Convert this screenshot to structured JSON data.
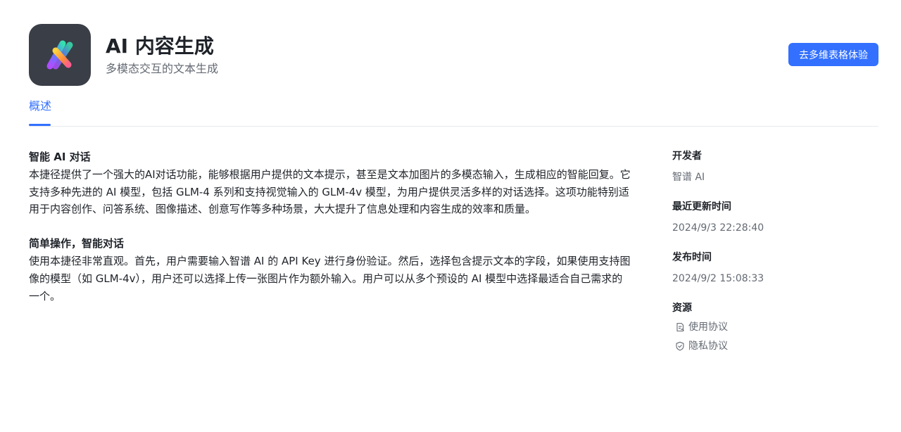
{
  "header": {
    "title": "AI 内容生成",
    "subtitle": "多模态交互的文本生成",
    "try_button_label": "去多维表格体验",
    "accent_color": "#3370ff",
    "icon_name": "ai-x-logo-icon"
  },
  "tabs": [
    {
      "label": "概述",
      "active": true
    }
  ],
  "main": {
    "sections": [
      {
        "heading": "智能 AI 对话",
        "body": "本捷径提供了一个强大的AI对话功能，能够根据用户提供的文本提示，甚至是文本加图片的多模态输入，生成相应的智能回复。它支持多种先进的 AI 模型，包括 GLM-4 系列和支持视觉输入的 GLM-4v 模型，为用户提供灵活多样的对话选择。这项功能特别适用于内容创作、问答系统、图像描述、创意写作等多种场景，大大提升了信息处理和内容生成的效率和质量。"
      },
      {
        "heading": "简单操作，智能对话",
        "body": "使用本捷径非常直观。首先，用户需要输入智谱 AI 的 API Key 进行身份验证。然后，选择包含提示文本的字段，如果使用支持图像的模型（如 GLM-4v），用户还可以选择上传一张图片作为额外输入。用户可以从多个预设的 AI 模型中选择最适合自己需求的一个。"
      }
    ]
  },
  "sidebar": {
    "developer": {
      "label": "开发者",
      "value": "智谱 AI"
    },
    "updated": {
      "label": "最近更新时间",
      "value": "2024/9/3 22:28:40"
    },
    "published": {
      "label": "发布时间",
      "value": "2024/9/2 15:08:33"
    },
    "resources": {
      "label": "资源",
      "links": [
        {
          "label": "使用协议",
          "icon": "document-icon"
        },
        {
          "label": "隐私协议",
          "icon": "shield-check-icon"
        }
      ]
    }
  }
}
